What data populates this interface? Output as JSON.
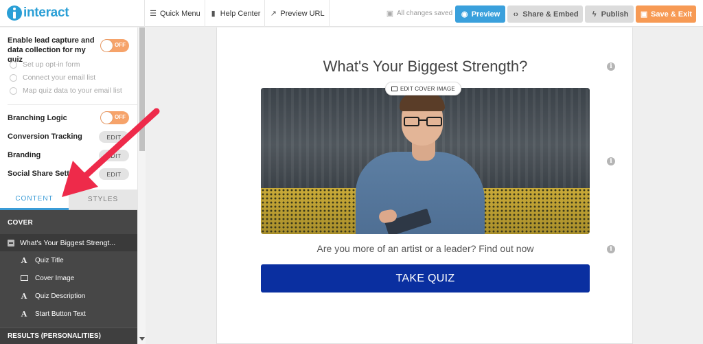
{
  "brand": {
    "logo_text": "interact"
  },
  "topnav": {
    "quick_menu": "Quick Menu",
    "help_center": "Help Center",
    "preview_url": "Preview URL"
  },
  "status": {
    "saved_text": "All changes saved"
  },
  "actions": {
    "preview": "Preview",
    "share_embed": "Share & Embed",
    "publish": "Publish",
    "save_exit": "Save & Exit"
  },
  "settings": {
    "lead_capture_label": "Enable lead capture and data collection for my quiz",
    "lead_capture_toggle": "OFF",
    "lead_options": [
      "Set up opt-in form",
      "Connect your email list",
      "Map quiz data to your email list"
    ],
    "branching_label": "Branching Logic",
    "branching_toggle": "OFF",
    "conversion_label": "Conversion Tracking",
    "branding_label": "Branding",
    "social_label": "Social Share Settings",
    "edit_label": "EDIT"
  },
  "tabs": {
    "content": "CONTENT",
    "styles": "STYLES"
  },
  "tree": {
    "cover_section": "COVER",
    "cover_item": "What's Your Biggest Strengt...",
    "sub_items": [
      "Quiz Title",
      "Cover Image",
      "Quiz Description",
      "Start Button Text"
    ],
    "results_section": "RESULTS (PERSONALITIES)"
  },
  "quiz": {
    "title": "What's Your Biggest Strength?",
    "edit_cover": "EDIT COVER IMAGE",
    "description": "Are you more of an artist or a leader? Find out now",
    "button": "TAKE QUIZ"
  },
  "colors": {
    "brand_blue": "#2a9fd6",
    "preview_blue": "#3aa0dc",
    "save_orange": "#f79a54",
    "toggle_orange": "#f6a36a",
    "take_quiz_navy": "#0a2fa0",
    "annotation_red": "#ee2a4a"
  },
  "icons": {
    "logo": "interact-logo-icon",
    "quick_menu": "hamburger-icon",
    "help_center": "book-icon",
    "preview_url": "external-link-icon",
    "saved": "floppy-disk-icon",
    "preview": "eye-icon",
    "share": "code-icon",
    "publish": "bolt-icon",
    "save": "floppy-disk-icon"
  }
}
